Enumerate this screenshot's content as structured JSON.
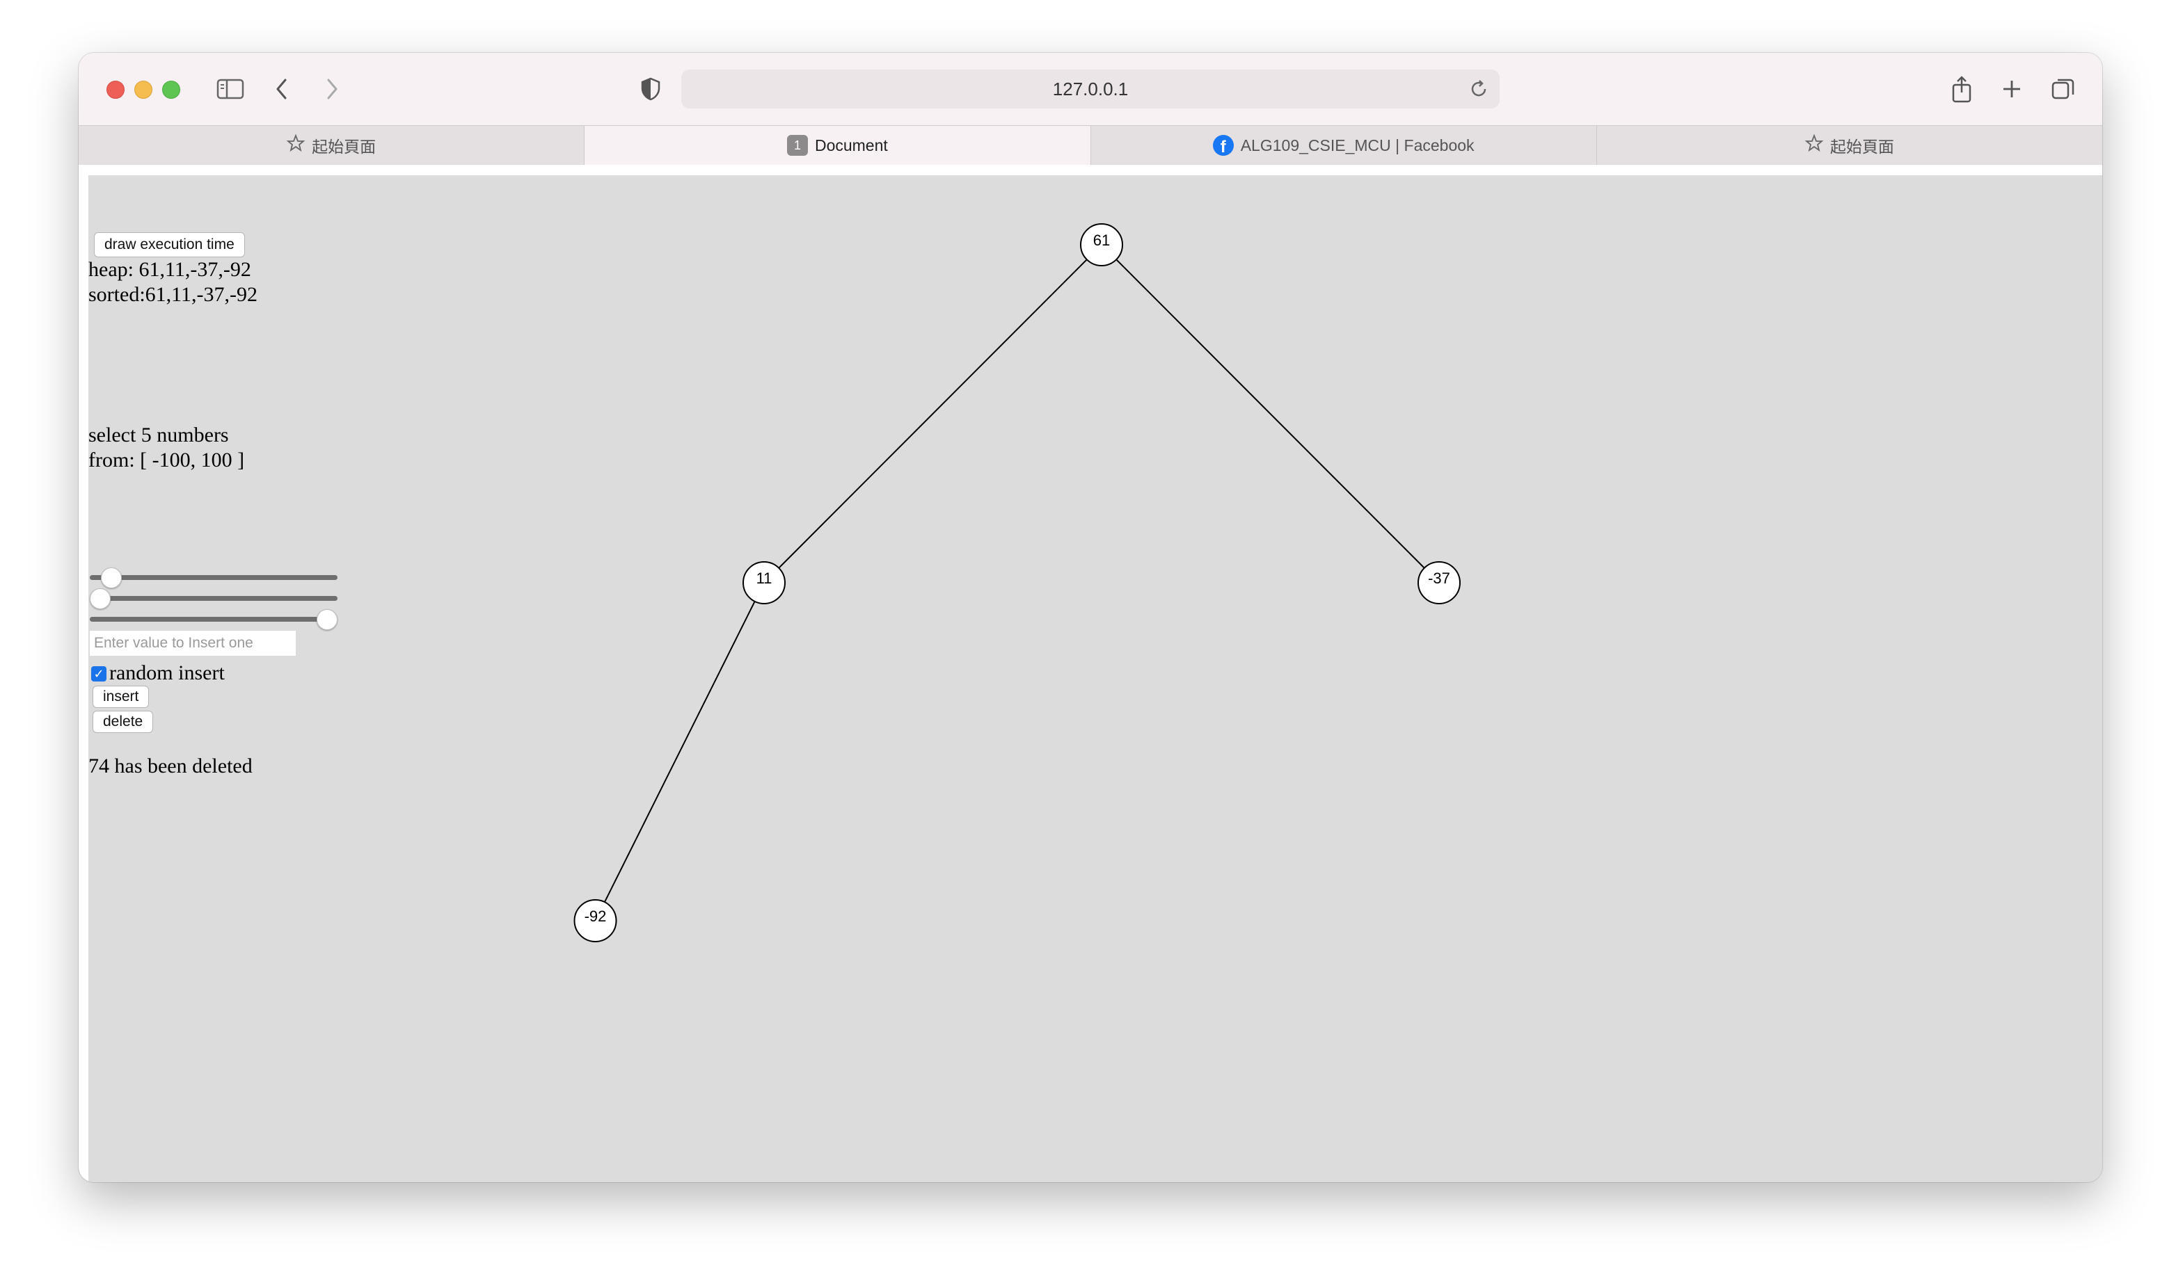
{
  "browser": {
    "url": "127.0.0.1",
    "tabs": [
      {
        "label": "起始頁面",
        "icon": "star-icon",
        "active": false
      },
      {
        "label": "Document",
        "icon": "tab-number-badge",
        "badge": "1",
        "active": true
      },
      {
        "label": "ALG109_CSIE_MCU | Facebook",
        "icon": "facebook-icon",
        "active": false
      },
      {
        "label": "起始頁面",
        "icon": "star-icon",
        "active": false
      }
    ]
  },
  "panel": {
    "draw_button": "draw execution time",
    "heap_text": "heap: 61,11,-37,-92",
    "sorted_text": "sorted:61,11,-37,-92",
    "select_line1": "select 5 numbers",
    "select_line2": "from: [ -100, 100 ]",
    "input_placeholder": "Enter value to Insert one",
    "random_insert_label": "random insert",
    "random_insert_checked": true,
    "insert_button": "insert",
    "delete_button": "delete",
    "status_text": "74 has been deleted",
    "sliders": [
      {
        "name": "count-slider",
        "fraction": 0.05
      },
      {
        "name": "min-slider",
        "fraction": 0.0
      },
      {
        "name": "max-slider",
        "fraction": 1.0
      }
    ]
  },
  "tree": {
    "nodes": [
      {
        "label": "61"
      },
      {
        "label": "11"
      },
      {
        "label": "-37"
      },
      {
        "label": "-92"
      }
    ]
  }
}
